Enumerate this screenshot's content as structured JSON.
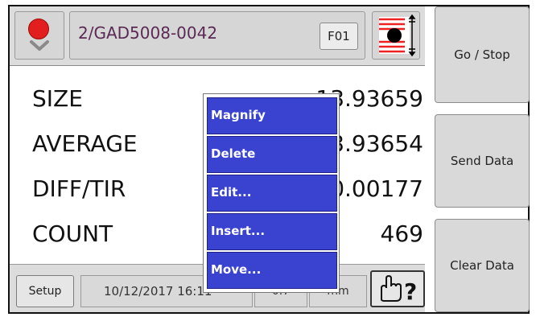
{
  "header": {
    "part_number": "2/GAD5008-0042",
    "feature_tag": "F01",
    "status_icon": "red-light-icon",
    "gauge_icon": "bore-gauge-icon"
  },
  "measurements": [
    {
      "label": "SIZE",
      "value": "13.93659"
    },
    {
      "label": "AVERAGE",
      "value": "13.93654"
    },
    {
      "label": "DIFF/TIR",
      "value": "0.00177"
    },
    {
      "label": "COUNT",
      "value": "469"
    }
  ],
  "side_buttons": {
    "go_stop": "Go / Stop",
    "send_data": "Send Data",
    "clear_data": "Clear Data"
  },
  "footer": {
    "setup": "Setup",
    "datetime": "10/12/2017 16:11",
    "box1": "0.7",
    "box2": "mm"
  },
  "context_menu": {
    "items": [
      "Magnify",
      "Delete",
      "Edit...",
      "Insert...",
      "Move..."
    ]
  },
  "colors": {
    "menu_bg": "#3a43cf",
    "status_red": "#e21e1e",
    "part_text": "#5a2a55"
  }
}
